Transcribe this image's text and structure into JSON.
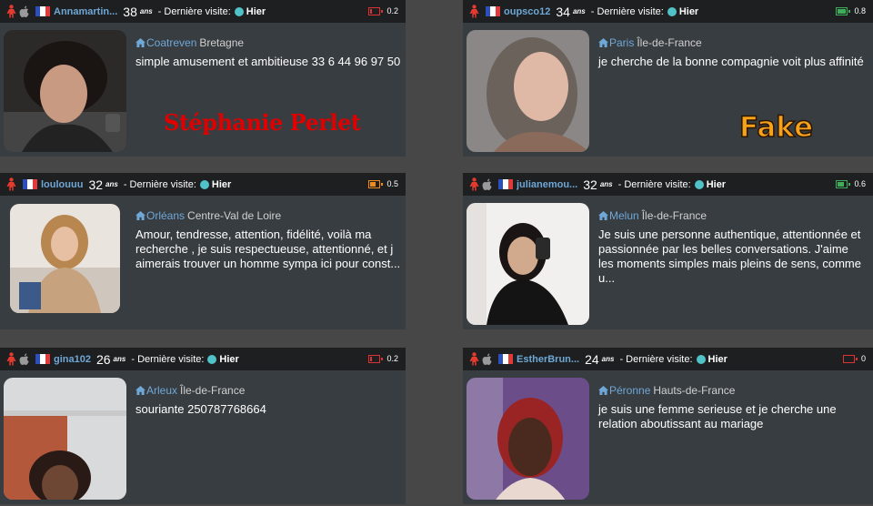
{
  "header_labels": {
    "ans": "ans",
    "derniere_visite": "- Dernière visite:",
    "hier": "Hier"
  },
  "profiles": [
    {
      "username": "Annamartin...",
      "age": "38",
      "battery": "0.2",
      "battery_color": "#d33333",
      "battery_fill": 0.2,
      "city": "Coatreven",
      "region": "Bretagne",
      "description": "simple amusement et ambitieuse 33 6 44 96 97 50",
      "watermark": "Stéphanie Perlet"
    },
    {
      "username": "oupsco12",
      "age": "34",
      "battery": "0.8",
      "battery_color": "#3fae5a",
      "battery_fill": 0.8,
      "city": "Paris",
      "region": "Île-de-France",
      "description": "je cherche de la bonne compagnie voit plus affinité",
      "watermark": "Fake"
    },
    {
      "username": "loulouuu",
      "age": "32",
      "battery": "0.5",
      "battery_color": "#f08a1a",
      "battery_fill": 0.5,
      "city": "Orléans",
      "region": "Centre-Val de Loire",
      "description": "Amour, tendresse, attention, fidélité, voilà ma recherche , je suis respectueuse, attentionné, et j aimerais trouver un homme sympa ici pour const..."
    },
    {
      "username": "julianemou...",
      "age": "32",
      "battery": "0.6",
      "battery_color": "#3fae5a",
      "battery_fill": 0.6,
      "city": "Melun",
      "region": "Île-de-France",
      "description": "Je suis une personne authentique, attentionnée et passionnée par les belles conversations. J'aime les moments simples mais pleins de sens, comme u..."
    },
    {
      "username": "gina102",
      "age": "26",
      "battery": "0.2",
      "battery_color": "#d33333",
      "battery_fill": 0.2,
      "city": "Arleux",
      "region": "Île-de-France",
      "description": "souriante 250787768664"
    },
    {
      "username": "EstherBrun...",
      "age": "24",
      "battery": "0",
      "battery_color": "#d33333",
      "battery_fill": 0,
      "city": "Péronne",
      "region": "Hauts-de-France",
      "description": "je suis une femme serieuse et je cherche une relation aboutissant au mariage"
    }
  ],
  "icons": {
    "gender": "female-icon",
    "os": "apple-icon",
    "flag": "france-flag-icon",
    "location": "home-icon",
    "online": "online-dot-icon",
    "battery": "battery-icon"
  },
  "colors": {
    "username": "#6fa7d6",
    "card_bg": "#383d42",
    "header_bg": "#1d1f21",
    "online_dot": "#4fc3c7",
    "gender_icon": "#e53a2f"
  }
}
